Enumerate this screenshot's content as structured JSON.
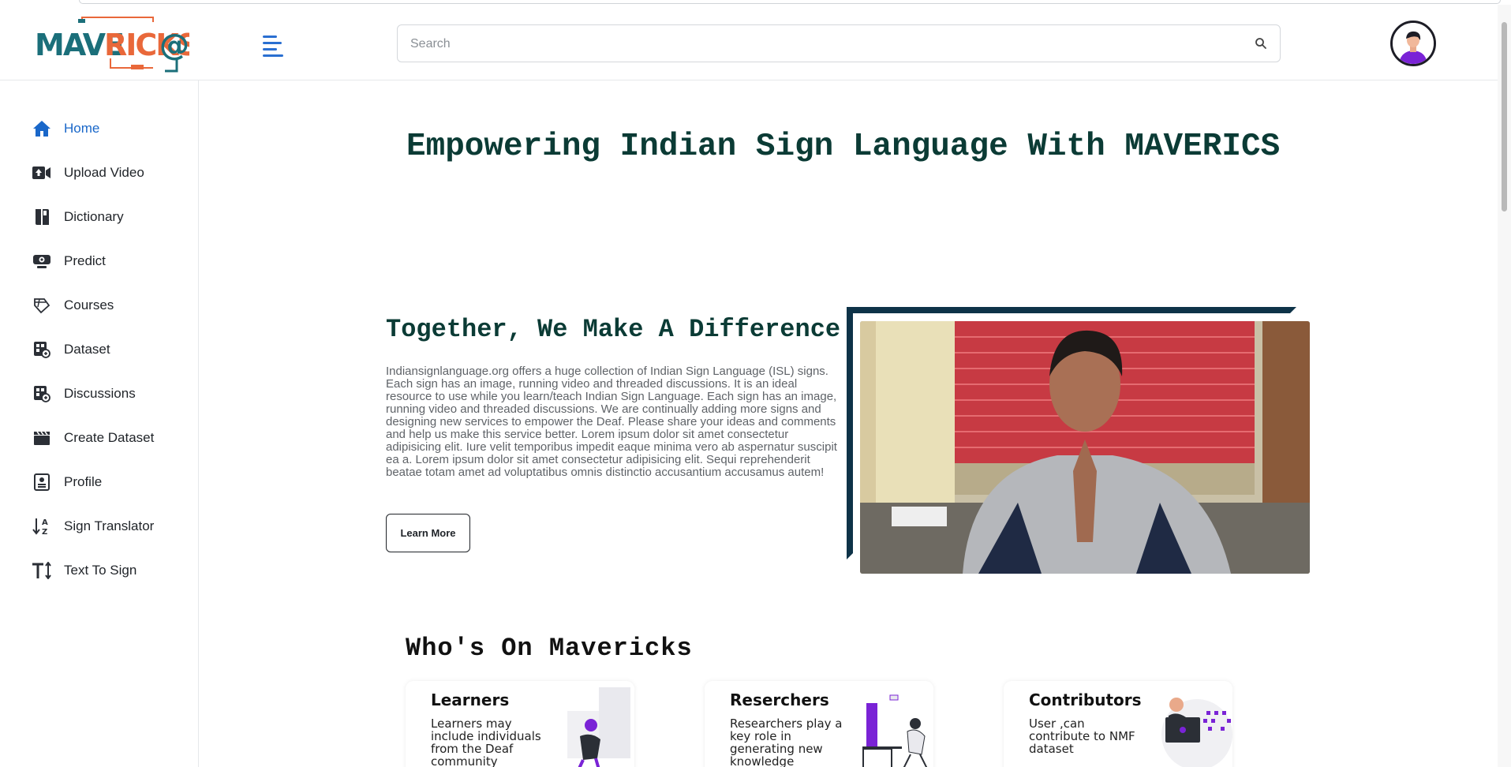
{
  "header": {
    "logo_text": "MAVERICKS@",
    "search_placeholder": "Search"
  },
  "sidebar": {
    "items": [
      {
        "label": "Home",
        "icon": "home-icon",
        "active": true
      },
      {
        "label": "Upload Video",
        "icon": "video-upload-icon"
      },
      {
        "label": "Dictionary",
        "icon": "book-icon"
      },
      {
        "label": "Predict",
        "icon": "webcam-icon"
      },
      {
        "label": "Courses",
        "icon": "diamond-icon"
      },
      {
        "label": "Dataset",
        "icon": "dataset-icon"
      },
      {
        "label": "Discussions",
        "icon": "discussion-icon"
      },
      {
        "label": "Create Dataset",
        "icon": "clapperboard-icon"
      },
      {
        "label": "Profile",
        "icon": "profile-icon"
      },
      {
        "label": "Sign Translator",
        "icon": "sort-az-icon"
      },
      {
        "label": "Text To Sign",
        "icon": "text-height-icon"
      }
    ]
  },
  "main": {
    "hero_title": "Empowering Indian Sign Language With MAVERICS",
    "section_title": "Together, We Make A Difference",
    "paragraph": "Indiansignlanguage.org offers a huge collection of Indian Sign Language (ISL) signs. Each sign has an image, running video and threaded discussions. It is an ideal resource to use while you learn/teach Indian Sign Language. Each sign has an image, running video and threaded discussions. We are continually adding more signs and designing new services to empower the Deaf. Please share your ideas and comments and help us make this service better. Lorem ipsum dolor sit amet consectetur adipisicing elit. Iure velit temporibus impedit eaque minima vero ab aspernatur suscipit ea a. Lorem ipsum dolor sit amet consectetur adipisicing elit. Sequi reprehenderit beatae totam amet ad voluptatibus omnis distinctio accusantium accusamus autem!",
    "learn_more_label": "Learn More",
    "who_title": "Who's On Mavericks",
    "cards": [
      {
        "title": "Learners",
        "text": "Learners may include individuals from the Deaf community"
      },
      {
        "title": "Reserchers",
        "text": "Researchers play a key role in generating new knowledge"
      },
      {
        "title": "Contributors",
        "text": "User ,can contribute to NMF dataset"
      }
    ]
  },
  "colors": {
    "accent_blue": "#1967c9",
    "title_green": "#0b3b35",
    "frame_navy": "#0e3348",
    "logo_teal": "#1b6f7a",
    "logo_orange": "#e9683a"
  }
}
